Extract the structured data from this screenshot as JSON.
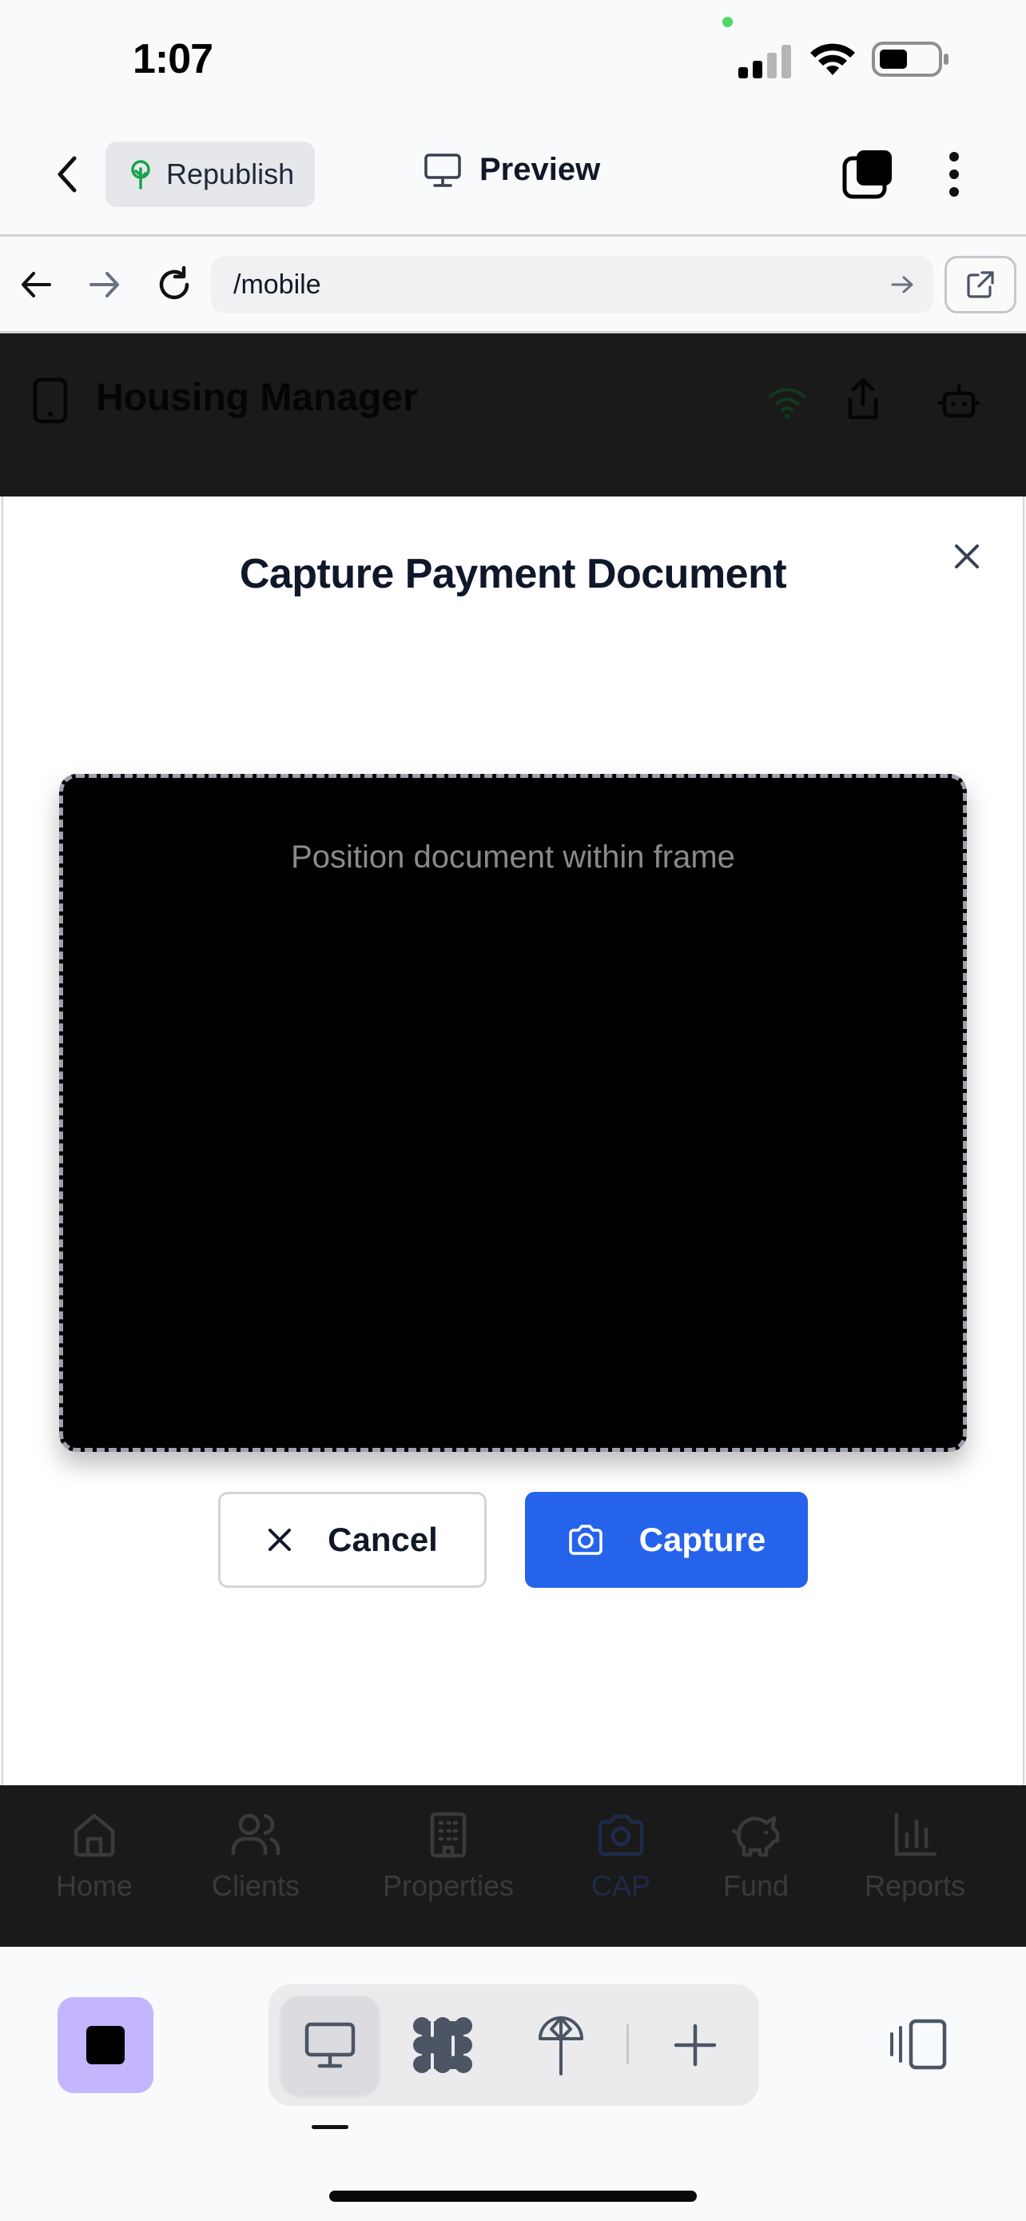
{
  "status_bar": {
    "time": "1:07"
  },
  "toolbar": {
    "republish_label": "Republish",
    "preview_label": "Preview"
  },
  "browser": {
    "url": "/mobile"
  },
  "app": {
    "title": "Housing Manager"
  },
  "modal": {
    "title": "Capture Payment Document",
    "frame_hint": "Position document within frame",
    "cancel_label": "Cancel",
    "capture_label": "Capture"
  },
  "bottom_nav": {
    "items": [
      {
        "label": "Home",
        "icon": "home-icon"
      },
      {
        "label": "Clients",
        "icon": "users-icon"
      },
      {
        "label": "Properties",
        "icon": "building-icon"
      },
      {
        "label": "CAP",
        "icon": "camera-icon",
        "active": true
      },
      {
        "label": "Fund",
        "icon": "piggy-bank-icon"
      },
      {
        "label": "Reports",
        "icon": "bar-chart-icon"
      }
    ]
  },
  "colors": {
    "primary": "#2563eb",
    "stop_button": "#c4b5fd",
    "overlay": "#1a1a1a"
  }
}
